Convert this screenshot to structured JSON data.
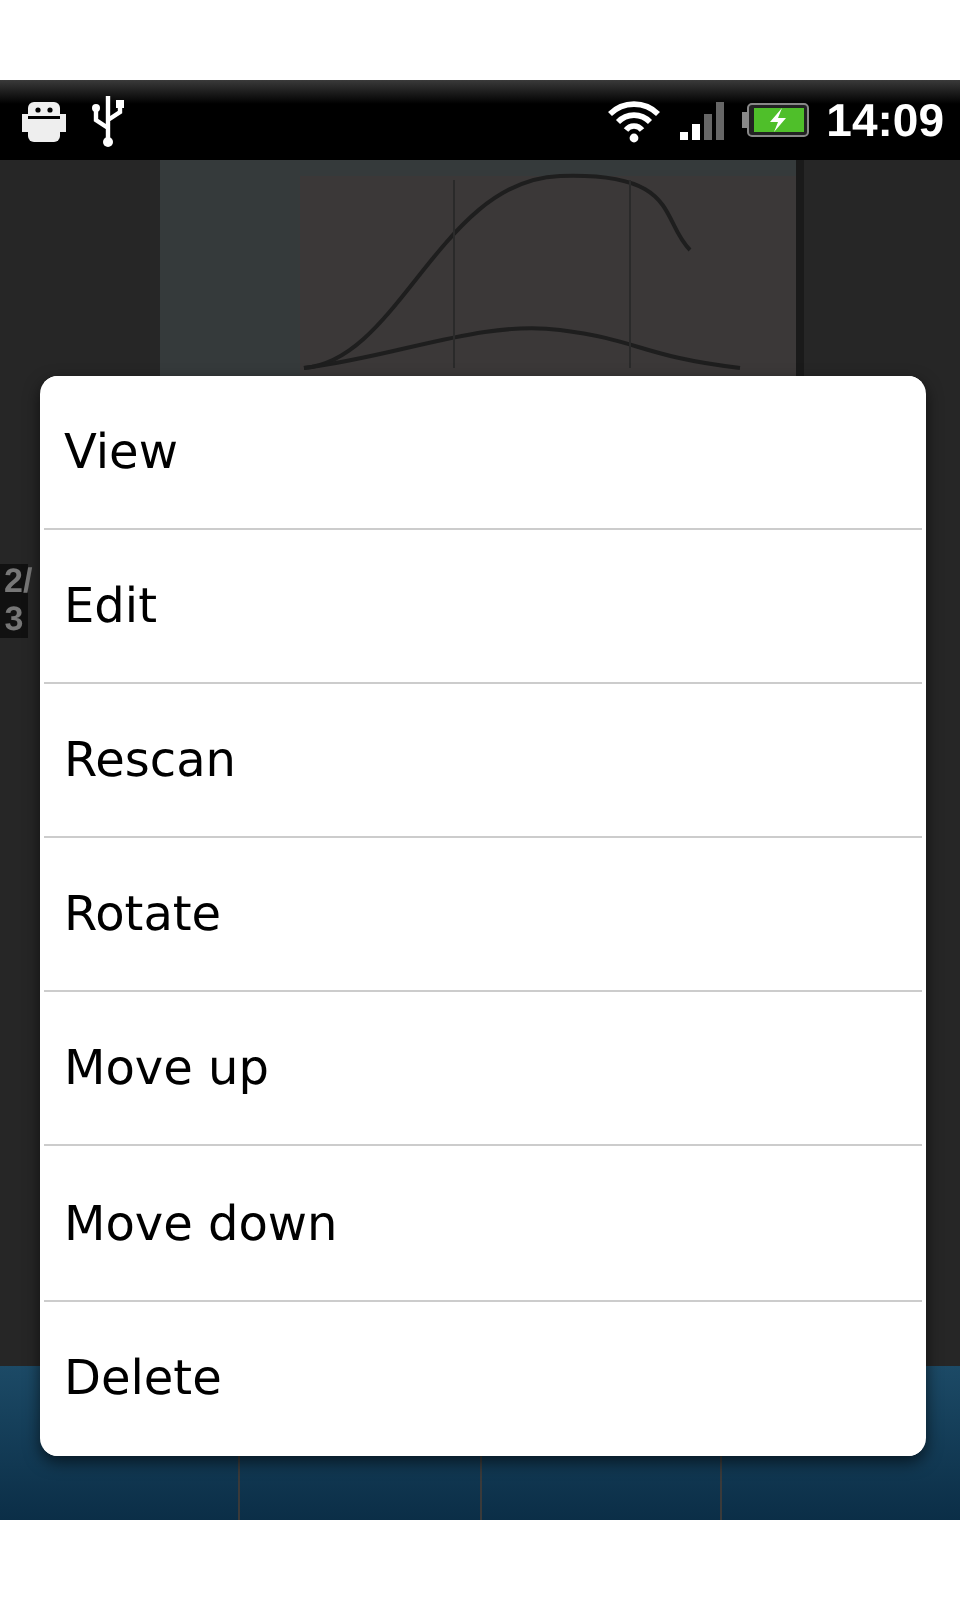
{
  "status_bar": {
    "time": "14:09"
  },
  "page_indicator": "2/3",
  "context_menu": {
    "items": [
      {
        "label": "View"
      },
      {
        "label": "Edit"
      },
      {
        "label": "Rescan"
      },
      {
        "label": "Rotate"
      },
      {
        "label": "Move up"
      },
      {
        "label": "Move down"
      },
      {
        "label": "Delete"
      }
    ]
  }
}
